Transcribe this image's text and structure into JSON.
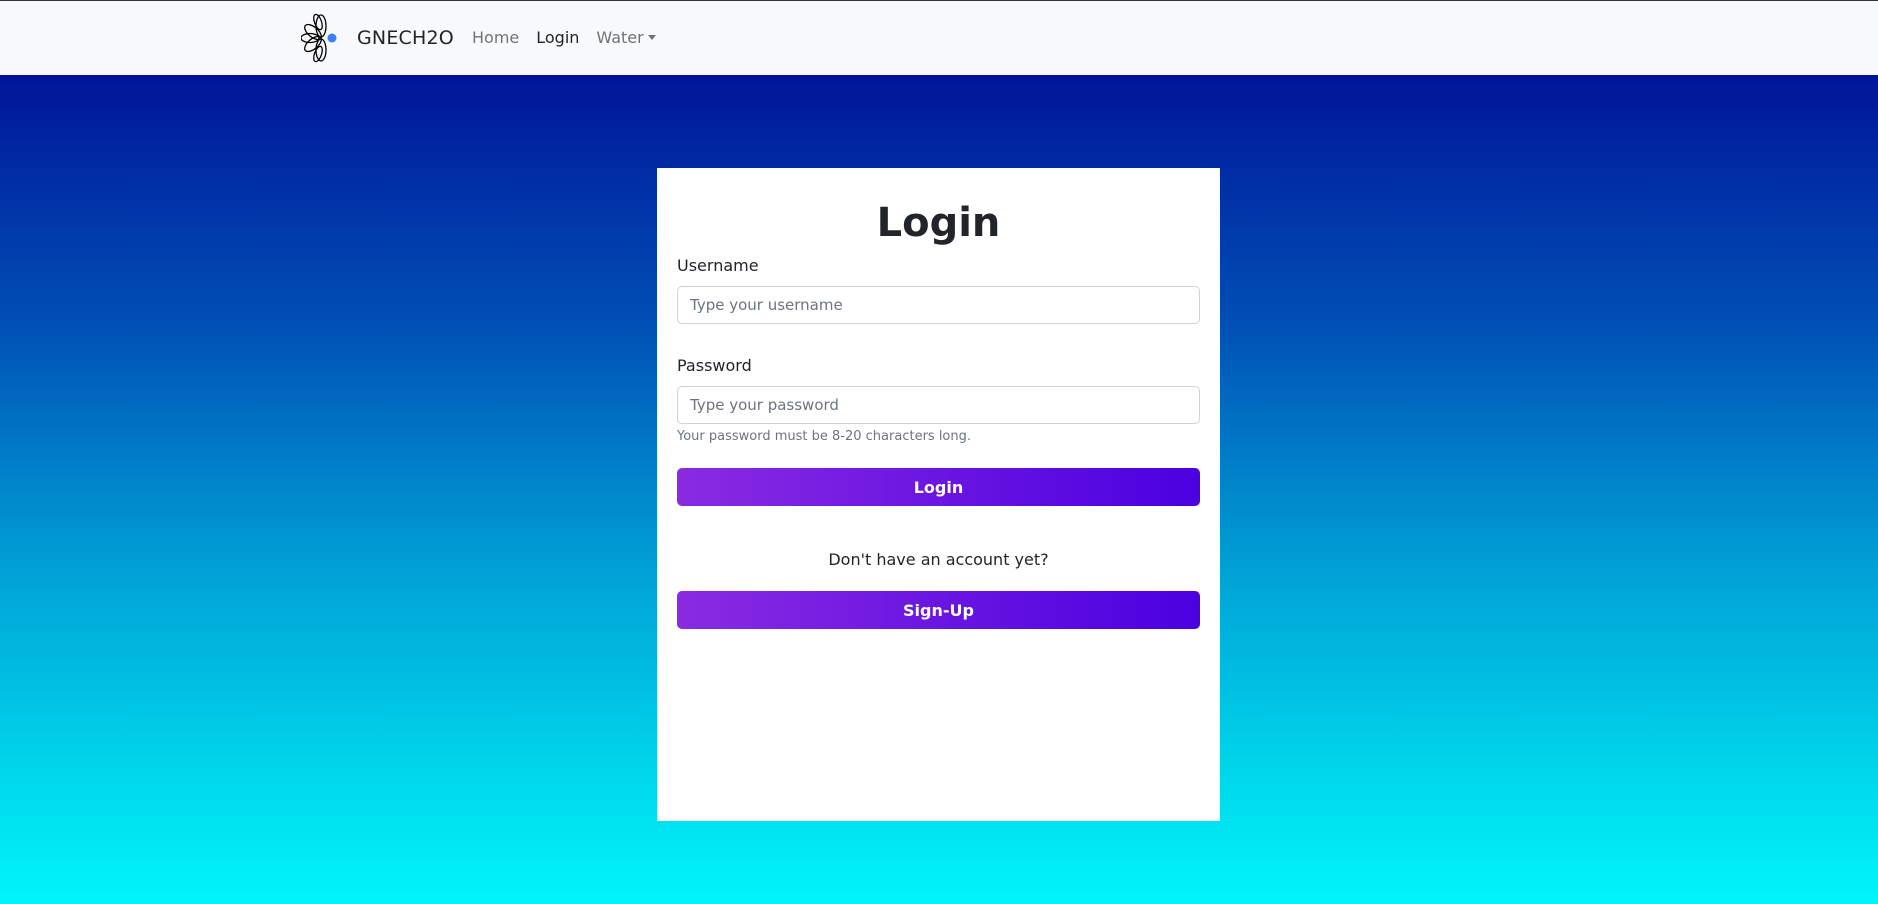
{
  "navbar": {
    "brand_name": "GNECH2O",
    "logo_icon": "flower-logo-icon",
    "links": {
      "home": "Home",
      "login": "Login",
      "water": "Water"
    }
  },
  "login_card": {
    "title": "Login",
    "username": {
      "label": "Username",
      "placeholder": "Type your username",
      "value": ""
    },
    "password": {
      "label": "Password",
      "placeholder": "Type your password",
      "value": "",
      "help": "Your password must be 8-20 characters long."
    },
    "login_button": "Login",
    "signup_prompt": "Don't have an account yet?",
    "signup_button": "Sign-Up"
  },
  "colors": {
    "gradient_top": "#00159a",
    "gradient_bottom": "#00f6fb",
    "button_start": "#8a2be2",
    "button_end": "#4a00e0",
    "logo_dot": "#3b82f6"
  }
}
